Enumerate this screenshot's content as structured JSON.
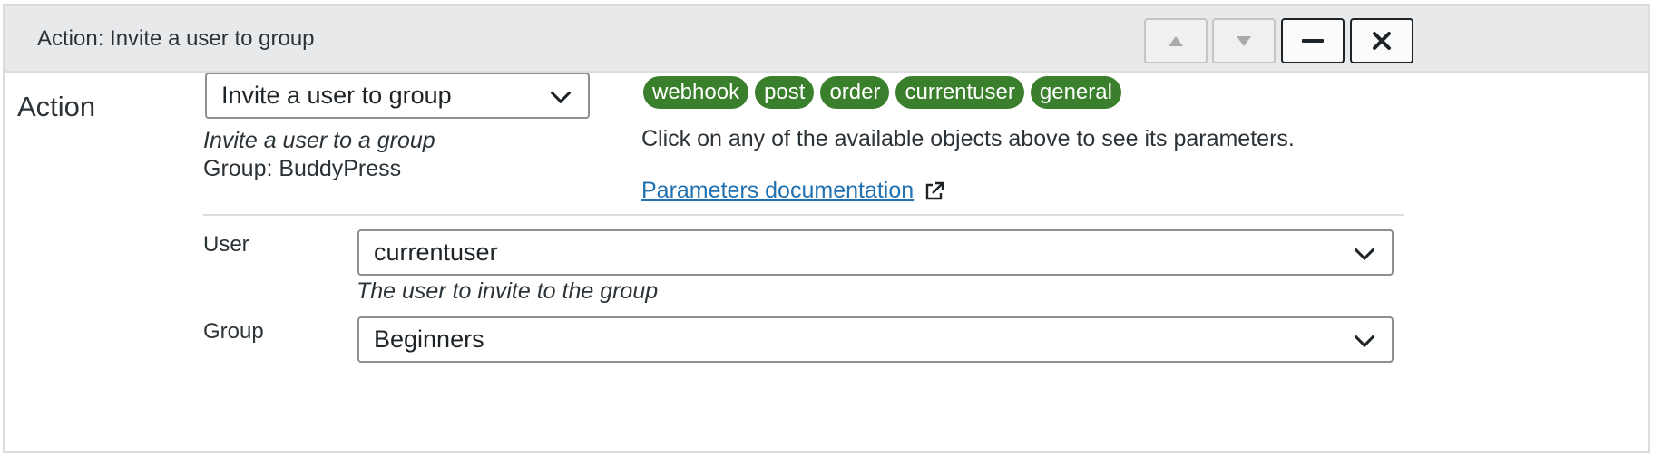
{
  "header": {
    "title": "Action: Invite a user to group",
    "move_up_icon": "triangle-up-icon",
    "move_down_icon": "triangle-down-icon",
    "collapse_icon": "minus-icon",
    "remove_icon": "close-icon"
  },
  "action": {
    "label": "Action",
    "selected": "Invite a user to group",
    "description": "Invite a user to a group",
    "group_line": "Group: BuddyPress"
  },
  "objects": {
    "tags": [
      "webhook",
      "post",
      "order",
      "currentuser",
      "general"
    ],
    "hint": "Click on any of the available objects above to see its parameters.",
    "doc_link": "Parameters documentation"
  },
  "fields": {
    "user": {
      "label": "User",
      "value": "currentuser",
      "description": "The user to invite to the group"
    },
    "group": {
      "label": "Group",
      "value": "Beginners"
    }
  },
  "colors": {
    "tag_bg": "#3a7f2b",
    "link": "#2271b1",
    "header_bg": "#e8e9eb"
  }
}
